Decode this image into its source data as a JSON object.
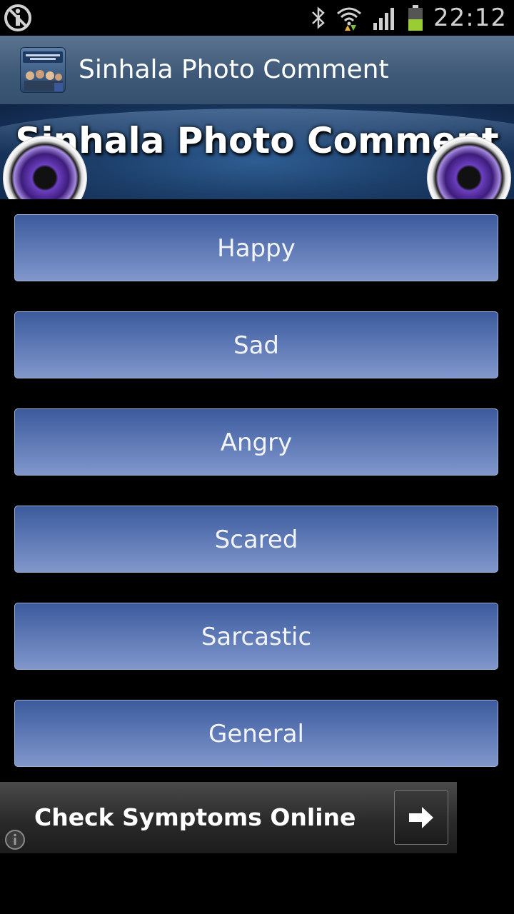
{
  "status_bar": {
    "time": "22:12"
  },
  "action_bar": {
    "title": "Sinhala Photo Comment"
  },
  "banner": {
    "title": "Sinhala Photo Comment"
  },
  "buttons": [
    {
      "label": "Happy"
    },
    {
      "label": "Sad"
    },
    {
      "label": "Angry"
    },
    {
      "label": "Scared"
    },
    {
      "label": "Sarcastic"
    },
    {
      "label": "General"
    }
  ],
  "ad": {
    "text": "Check Symptoms Online"
  },
  "colors": {
    "button_top": "#3c5a9c",
    "button_bottom": "#8197cc",
    "action_bar": "#3f5a78",
    "battery_level": "#9acd32"
  }
}
